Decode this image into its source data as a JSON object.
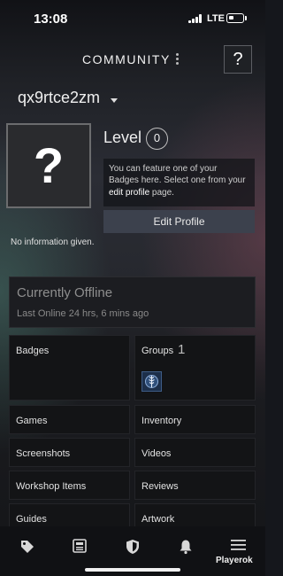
{
  "status_bar": {
    "time": "13:08",
    "network": "LTE"
  },
  "header": {
    "title": "COMMUNITY",
    "help_label": "?"
  },
  "profile": {
    "username": "qx9rtce2zm",
    "avatar_placeholder": "?",
    "level_label": "Level",
    "level_value": "0",
    "badge_note_text": "You can feature one of your Badges here. Select one from your",
    "badge_note_link": "edit profile",
    "badge_note_suffix": "page.",
    "edit_button": "Edit Profile",
    "summary": "No information given."
  },
  "online_status": {
    "title": "Currently Offline",
    "last_online": "Last Online 24 hrs, 6 mins ago"
  },
  "tiles": {
    "badges": "Badges",
    "groups": "Groups",
    "groups_count": "1",
    "games": "Games",
    "inventory": "Inventory",
    "screenshots": "Screenshots",
    "videos": "Videos",
    "workshop": "Workshop Items",
    "reviews": "Reviews",
    "guides": "Guides",
    "artwork": "Artwork"
  },
  "bottom_nav": {
    "items": [
      "store-tag-icon",
      "news-icon",
      "shield-icon",
      "bell-icon",
      "menu-icon"
    ]
  },
  "watermark": "Playerok",
  "colors": {
    "background": "#15171c",
    "tile": "#131416",
    "edit_button": "#3c414d"
  }
}
